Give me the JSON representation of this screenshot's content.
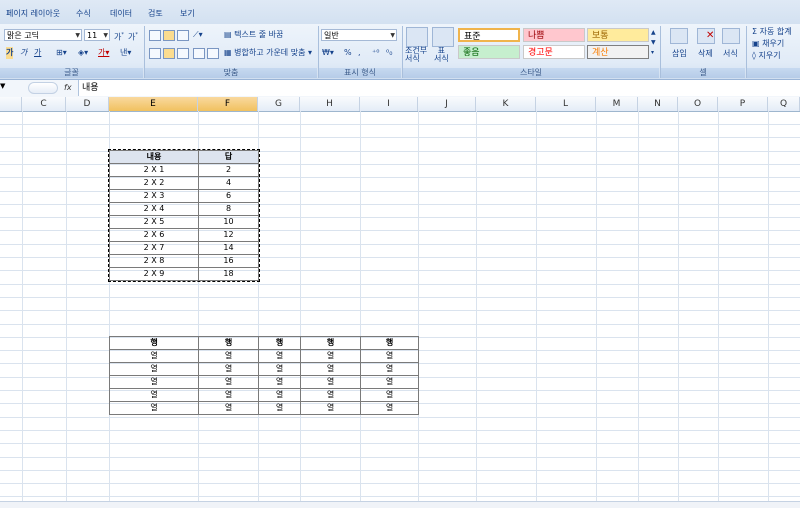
{
  "menu": [
    "페이지 레이아웃",
    "수식",
    "데이터",
    "검토",
    "보기"
  ],
  "ribbon": {
    "font_name": "맑은 고딕",
    "font_size": "11",
    "wrap_text": "텍스트 줄 바꿈",
    "merge_center": "병합하고 가운데 맞춤",
    "number_format": "일반",
    "cond_format": [
      "조건부",
      "서식"
    ],
    "table_format": [
      "표",
      "서식"
    ],
    "styles": {
      "standard": "표준",
      "bad": "나쁨",
      "neutral": "보통",
      "good": "좋음",
      "warning": "경고문",
      "calc": "계산"
    },
    "cells": {
      "insert": "삽입",
      "delete": "삭제",
      "format": "서식"
    },
    "editing": {
      "autosum": "자동 합계",
      "fill": "채우기",
      "clear": "지우기"
    },
    "groups": {
      "font": "글꼴",
      "alignment": "맞춤",
      "number": "표시 형식",
      "styles": "스타일",
      "cells": "셀"
    }
  },
  "formula_bar": {
    "fx": "fx",
    "content": "내용"
  },
  "columns": [
    "C",
    "D",
    "E",
    "F",
    "G",
    "H",
    "I",
    "J",
    "K",
    "L",
    "M",
    "N",
    "O",
    "P",
    "Q"
  ],
  "table1": {
    "headers": [
      "내용",
      "답"
    ],
    "rows": [
      [
        "2 X 1",
        "2"
      ],
      [
        "2 X 2",
        "4"
      ],
      [
        "2 X 3",
        "6"
      ],
      [
        "2 X 4",
        "8"
      ],
      [
        "2 X 5",
        "10"
      ],
      [
        "2 X 6",
        "12"
      ],
      [
        "2 X 7",
        "14"
      ],
      [
        "2 X 8",
        "16"
      ],
      [
        "2 X 9",
        "18"
      ]
    ]
  },
  "table2": {
    "headers": [
      "행",
      "행",
      "행",
      "행",
      "행"
    ],
    "rows": [
      [
        "열",
        "열",
        "열",
        "열",
        "열"
      ],
      [
        "열",
        "열",
        "열",
        "열",
        "열"
      ],
      [
        "열",
        "열",
        "열",
        "열",
        "열"
      ],
      [
        "열",
        "열",
        "열",
        "열",
        "열"
      ],
      [
        "열",
        "열",
        "열",
        "열",
        "열"
      ]
    ]
  }
}
